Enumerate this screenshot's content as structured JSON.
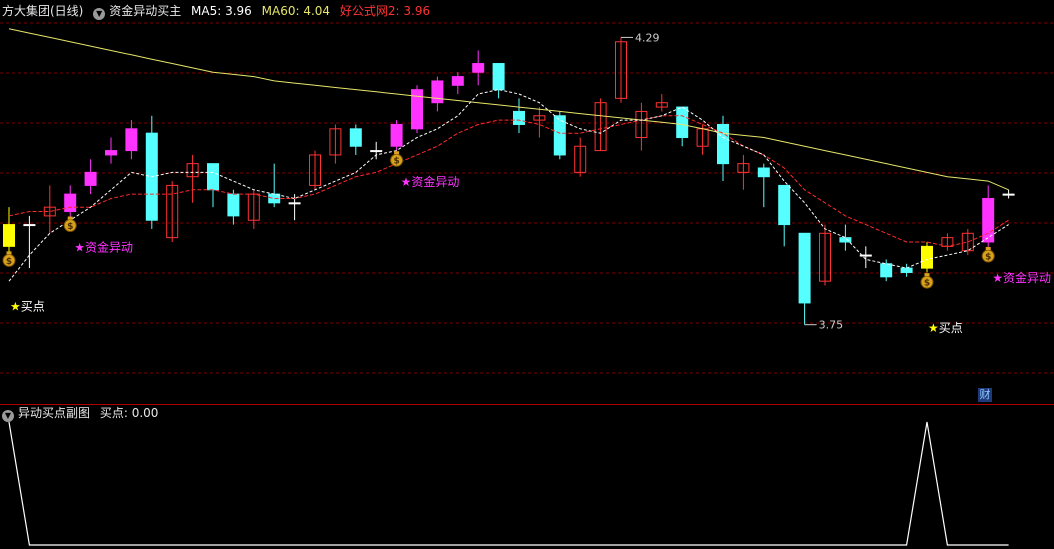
{
  "main_header": {
    "stock_name": "方大集团(日线)",
    "indicator_name": "资金异动买主",
    "ma5_label": "MA5: 3.96",
    "ma60_label": "MA60: 4.04",
    "formula_label": "好公式网2: 3.96"
  },
  "sub_header": {
    "indicator_name": "异动买点副图",
    "value_label": "买点: 0.00"
  },
  "colors": {
    "up": "#ff33ff",
    "down": "#55ffff",
    "neutral_up": "#ff3333",
    "buy_bar": "#ffff00",
    "ma60": "#e6e66a",
    "ma5": "#ffffff",
    "ma_red": "#ff2a2a",
    "grid": "#7a0000"
  },
  "chart_data": {
    "type": "candlestick",
    "ylim": [
      3.6,
      4.45
    ],
    "high_label": "4.29",
    "low_label": "3.75",
    "candles": [
      {
        "o": 3.93,
        "c": 3.98,
        "h": 4.02,
        "l": 3.9,
        "t": "buy"
      },
      {
        "o": 3.98,
        "c": 3.98,
        "h": 4.0,
        "l": 3.88,
        "t": "doji"
      },
      {
        "o": 4.0,
        "c": 4.02,
        "h": 4.07,
        "l": 3.96,
        "t": "hollow"
      },
      {
        "o": 4.01,
        "c": 4.05,
        "h": 4.07,
        "l": 3.99,
        "t": "up"
      },
      {
        "o": 4.07,
        "c": 4.1,
        "h": 4.13,
        "l": 4.05,
        "t": "up"
      },
      {
        "o": 4.14,
        "c": 4.15,
        "h": 4.18,
        "l": 4.12,
        "t": "up"
      },
      {
        "o": 4.15,
        "c": 4.2,
        "h": 4.22,
        "l": 4.13,
        "t": "up"
      },
      {
        "o": 4.19,
        "c": 3.99,
        "h": 4.23,
        "l": 3.97,
        "t": "down"
      },
      {
        "o": 3.95,
        "c": 4.07,
        "h": 4.08,
        "l": 3.94,
        "t": "hollow"
      },
      {
        "o": 4.09,
        "c": 4.12,
        "h": 4.14,
        "l": 4.03,
        "t": "hollow"
      },
      {
        "o": 4.12,
        "c": 4.06,
        "h": 4.12,
        "l": 4.02,
        "t": "down"
      },
      {
        "o": 4.05,
        "c": 4.0,
        "h": 4.06,
        "l": 3.98,
        "t": "down"
      },
      {
        "o": 3.99,
        "c": 4.05,
        "h": 4.06,
        "l": 3.97,
        "t": "hollow"
      },
      {
        "o": 4.05,
        "c": 4.03,
        "h": 4.12,
        "l": 4.02,
        "t": "down"
      },
      {
        "o": 4.03,
        "c": 4.03,
        "h": 4.05,
        "l": 3.99,
        "t": "doji"
      },
      {
        "o": 4.07,
        "c": 4.14,
        "h": 4.15,
        "l": 4.06,
        "t": "hollow"
      },
      {
        "o": 4.14,
        "c": 4.2,
        "h": 4.21,
        "l": 4.12,
        "t": "hollow"
      },
      {
        "o": 4.2,
        "c": 4.16,
        "h": 4.21,
        "l": 4.14,
        "t": "down"
      },
      {
        "o": 4.15,
        "c": 4.15,
        "h": 4.17,
        "l": 4.13,
        "t": "doji"
      },
      {
        "o": 4.16,
        "c": 4.21,
        "h": 4.22,
        "l": 4.15,
        "t": "up"
      },
      {
        "o": 4.2,
        "c": 4.29,
        "h": 4.3,
        "l": 4.19,
        "t": "up"
      },
      {
        "o": 4.26,
        "c": 4.31,
        "h": 4.32,
        "l": 4.24,
        "t": "up"
      },
      {
        "o": 4.3,
        "c": 4.32,
        "h": 4.33,
        "l": 4.28,
        "t": "up"
      },
      {
        "o": 4.33,
        "c": 4.35,
        "h": 4.38,
        "l": 4.3,
        "t": "up"
      },
      {
        "o": 4.35,
        "c": 4.29,
        "h": 4.35,
        "l": 4.27,
        "t": "down"
      },
      {
        "o": 4.24,
        "c": 4.21,
        "h": 4.27,
        "l": 4.19,
        "t": "down"
      },
      {
        "o": 4.22,
        "c": 4.23,
        "h": 4.25,
        "l": 4.18,
        "t": "hollow"
      },
      {
        "o": 4.23,
        "c": 4.14,
        "h": 4.24,
        "l": 4.13,
        "t": "down"
      },
      {
        "o": 4.1,
        "c": 4.16,
        "h": 4.18,
        "l": 4.09,
        "t": "hollow"
      },
      {
        "o": 4.15,
        "c": 4.26,
        "h": 4.27,
        "l": 4.15,
        "t": "hollow"
      },
      {
        "o": 4.27,
        "c": 4.4,
        "h": 4.41,
        "l": 4.26,
        "t": "hollow"
      },
      {
        "o": 4.24,
        "c": 4.18,
        "h": 4.26,
        "l": 4.15,
        "t": "hollow"
      },
      {
        "o": 4.25,
        "c": 4.26,
        "h": 4.28,
        "l": 4.24,
        "t": "hollow"
      },
      {
        "o": 4.25,
        "c": 4.18,
        "h": 4.25,
        "l": 4.16,
        "t": "down"
      },
      {
        "o": 4.2,
        "c": 4.16,
        "h": 4.21,
        "l": 4.14,
        "t": "hollow"
      },
      {
        "o": 4.21,
        "c": 4.12,
        "h": 4.23,
        "l": 4.08,
        "t": "down"
      },
      {
        "o": 4.12,
        "c": 4.1,
        "h": 4.14,
        "l": 4.06,
        "t": "hollow"
      },
      {
        "o": 4.11,
        "c": 4.09,
        "h": 4.12,
        "l": 4.02,
        "t": "down"
      },
      {
        "o": 4.07,
        "c": 3.98,
        "h": 4.07,
        "l": 3.93,
        "t": "down"
      },
      {
        "o": 3.96,
        "c": 3.8,
        "h": 3.96,
        "l": 3.75,
        "t": "down"
      },
      {
        "o": 3.85,
        "c": 3.96,
        "h": 3.98,
        "l": 3.84,
        "t": "hollow"
      },
      {
        "o": 3.95,
        "c": 3.94,
        "h": 3.98,
        "l": 3.92,
        "t": "down"
      },
      {
        "o": 3.91,
        "c": 3.91,
        "h": 3.93,
        "l": 3.88,
        "t": "doji"
      },
      {
        "o": 3.89,
        "c": 3.86,
        "h": 3.9,
        "l": 3.85,
        "t": "down"
      },
      {
        "o": 3.88,
        "c": 3.87,
        "h": 3.89,
        "l": 3.86,
        "t": "down"
      },
      {
        "o": 3.88,
        "c": 3.93,
        "h": 3.94,
        "l": 3.87,
        "t": "buy"
      },
      {
        "o": 3.93,
        "c": 3.95,
        "h": 3.96,
        "l": 3.92,
        "t": "hollow"
      },
      {
        "o": 3.92,
        "c": 3.96,
        "h": 3.97,
        "l": 3.91,
        "t": "hollow"
      },
      {
        "o": 3.94,
        "c": 4.04,
        "h": 4.07,
        "l": 3.92,
        "t": "up"
      },
      {
        "o": 4.05,
        "c": 4.05,
        "h": 4.06,
        "l": 4.04,
        "t": "doji"
      }
    ],
    "ma60": [
      4.43,
      4.42,
      4.41,
      4.4,
      4.39,
      4.38,
      4.37,
      4.36,
      4.35,
      4.34,
      4.33,
      4.325,
      4.32,
      4.31,
      4.305,
      4.3,
      4.295,
      4.29,
      4.285,
      4.28,
      4.275,
      4.27,
      4.265,
      4.26,
      4.255,
      4.25,
      4.245,
      4.24,
      4.235,
      4.23,
      4.225,
      4.22,
      4.215,
      4.21,
      4.2,
      4.19,
      4.185,
      4.18,
      4.17,
      4.16,
      4.15,
      4.14,
      4.13,
      4.12,
      4.11,
      4.1,
      4.09,
      4.085,
      4.08,
      4.06
    ],
    "ma5": [
      3.85,
      3.91,
      3.96,
      3.99,
      4.02,
      4.06,
      4.1,
      4.09,
      4.1,
      4.1,
      4.1,
      4.08,
      4.06,
      4.05,
      4.04,
      4.06,
      4.08,
      4.1,
      4.14,
      4.15,
      4.18,
      4.2,
      4.23,
      4.28,
      4.29,
      4.28,
      4.26,
      4.22,
      4.2,
      4.19,
      4.22,
      4.22,
      4.23,
      4.25,
      4.22,
      4.18,
      4.16,
      4.14,
      4.08,
      4.03,
      3.97,
      3.95,
      3.9,
      3.89,
      3.88,
      3.9,
      3.91,
      3.92,
      3.95,
      3.98
    ],
    "ma_red": [
      4.0,
      4.01,
      4.01,
      4.02,
      4.02,
      4.04,
      4.05,
      4.05,
      4.05,
      4.06,
      4.06,
      4.05,
      4.05,
      4.04,
      4.04,
      4.05,
      4.07,
      4.09,
      4.1,
      4.12,
      4.14,
      4.16,
      4.19,
      4.21,
      4.22,
      4.22,
      4.21,
      4.19,
      4.19,
      4.2,
      4.21,
      4.22,
      4.23,
      4.23,
      4.21,
      4.19,
      4.16,
      4.14,
      4.11,
      4.06,
      4.03,
      4.0,
      3.98,
      3.96,
      3.94,
      3.94,
      3.93,
      3.94,
      3.96,
      3.99
    ],
    "sub_values": [
      1,
      0,
      0,
      0,
      0,
      0,
      0,
      0,
      0,
      0,
      0,
      0,
      0,
      0,
      0,
      0,
      0,
      0,
      0,
      0,
      0,
      0,
      0,
      0,
      0,
      0,
      0,
      0,
      0,
      0,
      0,
      0,
      0,
      0,
      0,
      0,
      0,
      0,
      0,
      0,
      0,
      0,
      0,
      0,
      0,
      1,
      0,
      0,
      0,
      0
    ],
    "annotations": [
      {
        "index": 0,
        "text": "买点",
        "kind": "buy"
      },
      {
        "index": 3,
        "text": "资金异动",
        "kind": "flow"
      },
      {
        "index": 19,
        "text": "资金异动",
        "kind": "flow"
      },
      {
        "index": 45,
        "text": "买点",
        "kind": "buy"
      },
      {
        "index": 48,
        "text": "资金异动",
        "kind": "flow"
      }
    ],
    "money_bag_indices": [
      0,
      3,
      19,
      45,
      48
    ]
  },
  "badge": {
    "label": "财"
  }
}
